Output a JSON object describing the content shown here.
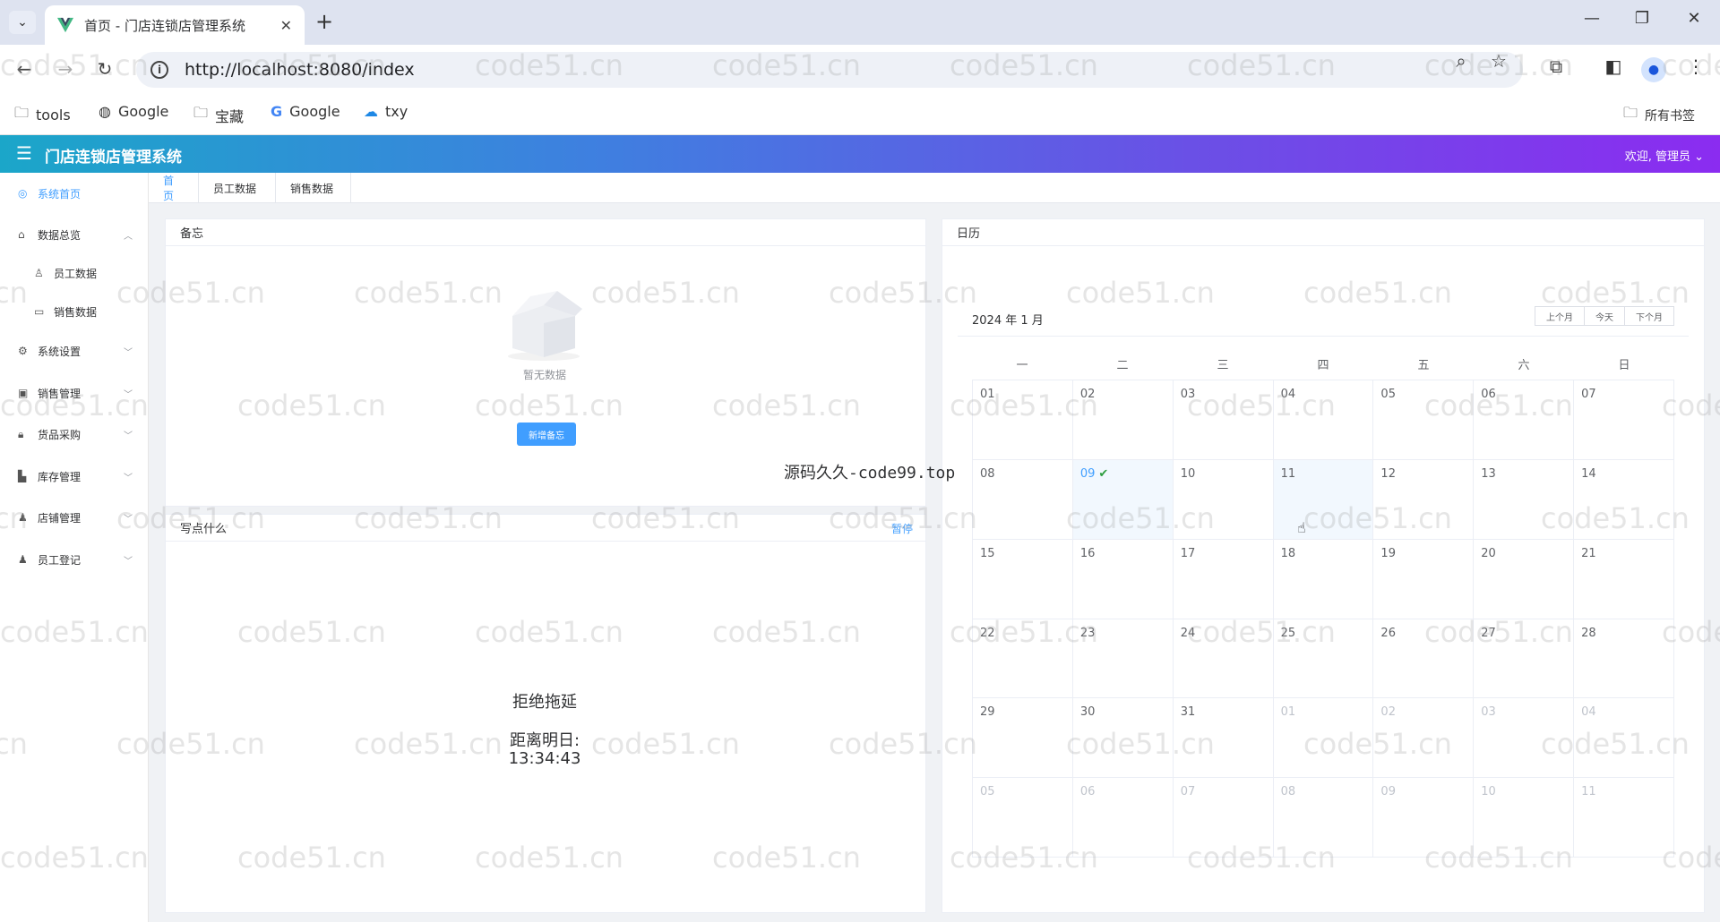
{
  "browser": {
    "tab_title": "首页 - 门店连锁店管理系统",
    "tab_close": "✕",
    "new_tab": "+",
    "url": "http://localhost:8080/index",
    "bookmarks": [
      {
        "icon": "folder-icon",
        "label": "tools"
      },
      {
        "icon": "globe-icon",
        "label": "Google"
      },
      {
        "icon": "folder-icon",
        "label": "宝藏"
      },
      {
        "icon": "google-icon",
        "label": "Google"
      },
      {
        "icon": "cloud-icon",
        "label": "txy"
      }
    ],
    "all_bookmarks": "所有书签"
  },
  "header": {
    "title": "门店连锁店管理系统",
    "welcome": "欢迎, 管理员"
  },
  "sidebar": {
    "items": [
      {
        "label": "系统首页",
        "icon": "dashboard-icon"
      },
      {
        "label": "数据总览",
        "icon": "home-icon"
      },
      {
        "label": "员工数据",
        "icon": "user-icon"
      },
      {
        "label": "销售数据",
        "icon": "chart-icon"
      },
      {
        "label": "系统设置",
        "icon": "gear-icon"
      },
      {
        "label": "销售管理",
        "icon": "sales-icon"
      },
      {
        "label": "货品采购",
        "icon": "lock-icon"
      },
      {
        "label": "库存管理",
        "icon": "warehouse-icon"
      },
      {
        "label": "店铺管理",
        "icon": "store-icon"
      },
      {
        "label": "员工登记",
        "icon": "person-icon"
      }
    ]
  },
  "page_tabs": [
    "首页",
    "员工数据",
    "销售数据"
  ],
  "memo": {
    "title": "备忘",
    "empty": "暂无数据",
    "add_button": "新增备忘"
  },
  "write": {
    "title": "写点什么",
    "pause": "暂停",
    "motto": "拒绝拖延",
    "countdown_label": "距离明日:",
    "countdown_time": "13:34:43"
  },
  "overlay_text": "源码久久-code99.top",
  "watermark": "code51.cn",
  "calendar": {
    "title": "日历",
    "month_label": "2024 年 1 月",
    "prev": "上个月",
    "today": "今天",
    "next": "下个月",
    "weekdays": [
      "一",
      "二",
      "三",
      "四",
      "五",
      "六",
      "日"
    ],
    "days": [
      [
        "01",
        "02",
        "03",
        "04",
        "05",
        "06",
        "07"
      ],
      [
        "08",
        "09",
        "10",
        "11",
        "12",
        "13",
        "14"
      ],
      [
        "15",
        "16",
        "17",
        "18",
        "19",
        "20",
        "21"
      ],
      [
        "22",
        "23",
        "24",
        "25",
        "26",
        "27",
        "28"
      ],
      [
        "29",
        "30",
        "31",
        "01",
        "02",
        "03",
        "04"
      ],
      [
        "05",
        "06",
        "07",
        "08",
        "09",
        "10",
        "11"
      ]
    ],
    "today_day": "09",
    "selected_day": "11"
  },
  "colors": {
    "accent": "#409eff",
    "header_start": "#1ba6c9",
    "header_end": "#8b2cf0",
    "check": "#2e9d3f"
  }
}
